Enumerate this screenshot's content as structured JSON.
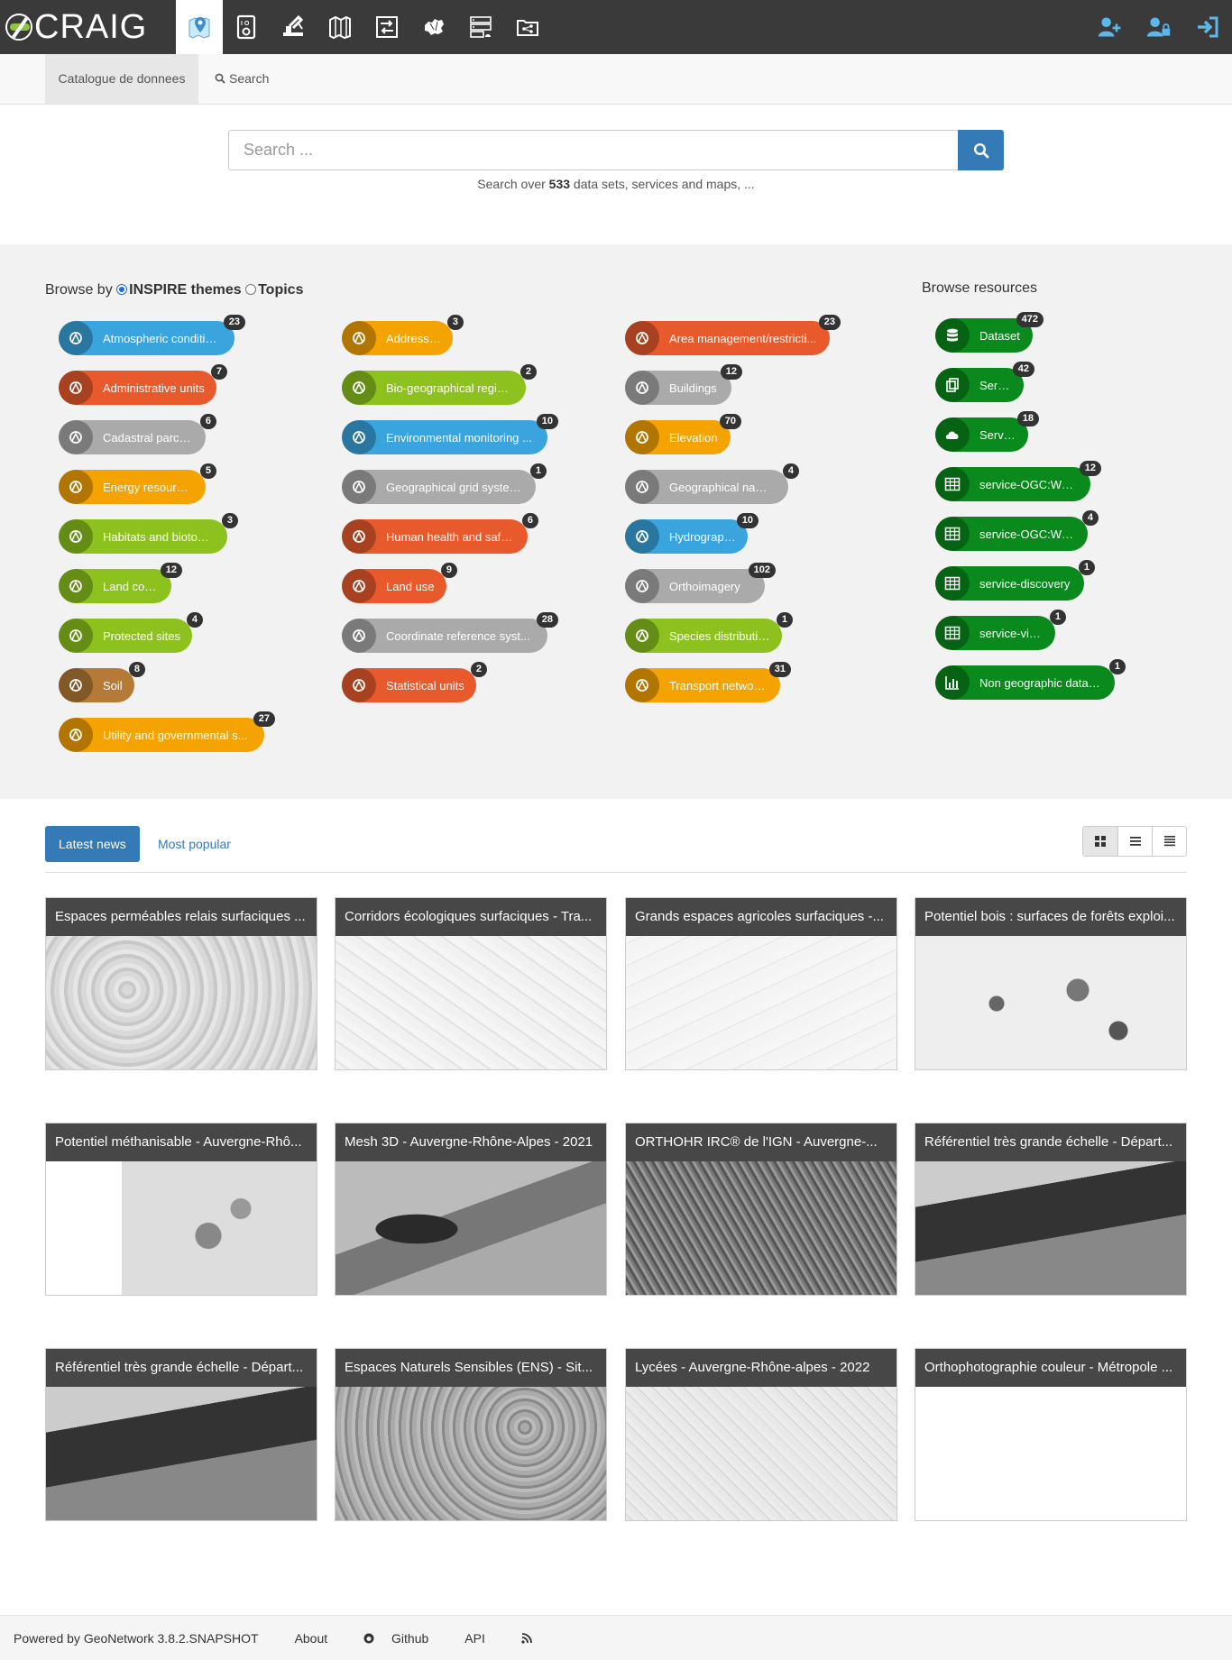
{
  "brand": {
    "name": "CRAIG"
  },
  "nav": {
    "icons": [
      "map-pin-icon",
      "panel-icon",
      "crane-icon",
      "map-fold-icon",
      "exchange-icon",
      "region-map-icon",
      "server-list-icon",
      "folder-share-icon"
    ],
    "right_icons": [
      "user-plus-icon",
      "user-lock-icon",
      "sign-in-icon"
    ]
  },
  "subnav": {
    "catalogue": "Catalogue de donnees",
    "search": "Search"
  },
  "search": {
    "placeholder": "Search ...",
    "hint_before": "Search over",
    "count": "533",
    "hint_after": "data sets, services and maps, ..."
  },
  "browse": {
    "label": "Browse by",
    "option_inspire": "INSPIRE themes",
    "option_topics": "Topics",
    "resources_title": "Browse resources",
    "themes": [
      {
        "label": "Atmospheric conditions",
        "count": "23",
        "color": "#3aa4de"
      },
      {
        "label": "Administrative units",
        "count": "7",
        "color": "#e85a2c"
      },
      {
        "label": "Cadastral parcels",
        "count": "6",
        "color": "#aaaaaa"
      },
      {
        "label": "Energy resources",
        "count": "5",
        "color": "#f5a300"
      },
      {
        "label": "Habitats and biotopes",
        "count": "3",
        "color": "#8dc21e"
      },
      {
        "label": "Land cover",
        "count": "12",
        "color": "#8dc21e"
      },
      {
        "label": "Protected sites",
        "count": "4",
        "color": "#8dc21e"
      },
      {
        "label": "Soil",
        "count": "8",
        "color": "#b57b36"
      },
      {
        "label": "Utility and governmental s...",
        "count": "27",
        "color": "#f5a300"
      },
      {
        "label": "Addresses",
        "count": "3",
        "color": "#f5a300"
      },
      {
        "label": "Bio-geographical regions",
        "count": "2",
        "color": "#8dc21e"
      },
      {
        "label": "Environmental monitoring ...",
        "count": "10",
        "color": "#3aa4de"
      },
      {
        "label": "Geographical grid systems",
        "count": "1",
        "color": "#aaaaaa"
      },
      {
        "label": "Human health and safety",
        "count": "6",
        "color": "#e85a2c"
      },
      {
        "label": "Land use",
        "count": "9",
        "color": "#e85a2c"
      },
      {
        "label": "Coordinate reference syst...",
        "count": "28",
        "color": "#aaaaaa"
      },
      {
        "label": "Statistical units",
        "count": "2",
        "color": "#e85a2c"
      },
      {
        "label": "Area management/restricti...",
        "count": "23",
        "color": "#e85a2c"
      },
      {
        "label": "Buildings",
        "count": "12",
        "color": "#aaaaaa"
      },
      {
        "label": "Elevation",
        "count": "70",
        "color": "#f5a300"
      },
      {
        "label": "Geographical names",
        "count": "4",
        "color": "#aaaaaa"
      },
      {
        "label": "Hydrography",
        "count": "10",
        "color": "#3aa4de"
      },
      {
        "label": "Orthoimagery",
        "count": "102",
        "color": "#aaaaaa"
      },
      {
        "label": "Species distribution",
        "count": "1",
        "color": "#8dc21e"
      },
      {
        "label": "Transport networks",
        "count": "31",
        "color": "#f5a300"
      }
    ],
    "resources": [
      {
        "label": "Dataset",
        "count": "472"
      },
      {
        "label": "Series",
        "count": "42"
      },
      {
        "label": "Service",
        "count": "18"
      },
      {
        "label": "service-OGC:WMS",
        "count": "12"
      },
      {
        "label": "service-OGC:WFS",
        "count": "4"
      },
      {
        "label": "service-discovery",
        "count": "1"
      },
      {
        "label": "service-view",
        "count": "1"
      },
      {
        "label": "Non geographic dataset",
        "count": "1"
      }
    ]
  },
  "tabs": {
    "latest": "Latest news",
    "popular": "Most popular"
  },
  "cards": [
    "Espaces perméables relais surfaciques ...",
    "Corridors écologiques surfaciques - Tra...",
    "Grands espaces agricoles surfaciques -...",
    "Potentiel bois : surfaces de forêts exploi...",
    "Potentiel méthanisable - Auvergne-Rhô...",
    "Mesh 3D - Auvergne-Rhône-Alpes - 2021",
    "ORTHOHR IRC® de l'IGN - Auvergne-...",
    "Référentiel très grande échelle - Départ...",
    "Référentiel très grande échelle - Départ...",
    "Espaces Naturels Sensibles (ENS) - Sit...",
    "Lycées - Auvergne-Rhône-alpes - 2022",
    "Orthophotographie couleur - Métropole ..."
  ],
  "footer": {
    "powered": "Powered by GeoNetwork 3.8.2.SNAPSHOT",
    "about": "About",
    "github": "Github",
    "api": "API"
  }
}
